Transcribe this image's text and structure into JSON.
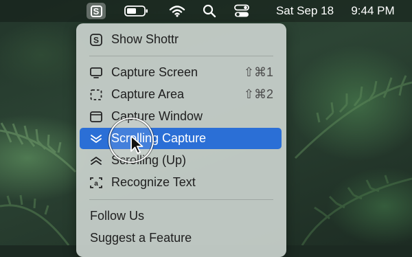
{
  "menubar": {
    "app_icon_letter": "S",
    "icons": [
      "battery-icon",
      "wifi-icon",
      "search-icon",
      "control-center-icon"
    ],
    "date": "Sat Sep 18",
    "time": "9:44 PM"
  },
  "menu": {
    "items": [
      {
        "label": "Show Shottr",
        "icon": "shottr-logo-icon",
        "shortcut": ""
      },
      {
        "label": "Capture Screen",
        "icon": "monitor-icon",
        "shortcut": "⇧⌘1"
      },
      {
        "label": "Capture Area",
        "icon": "dashed-area-icon",
        "shortcut": "⇧⌘2"
      },
      {
        "label": "Capture Window",
        "icon": "window-icon",
        "shortcut": ""
      },
      {
        "label": "Scrolling Capture",
        "icon": "chevrons-down-icon",
        "shortcut": "",
        "selected": true
      },
      {
        "label": "Scrolling (Up)",
        "icon": "chevrons-up-icon",
        "shortcut": ""
      },
      {
        "label": "Recognize Text",
        "icon": "text-recognition-icon",
        "shortcut": ""
      },
      {
        "label": "Follow Us",
        "icon": "",
        "shortcut": ""
      },
      {
        "label": "Suggest a Feature",
        "icon": "",
        "shortcut": ""
      }
    ]
  },
  "colors": {
    "selection": "#2b6fd6",
    "menu_bg": "#ced6d1"
  }
}
